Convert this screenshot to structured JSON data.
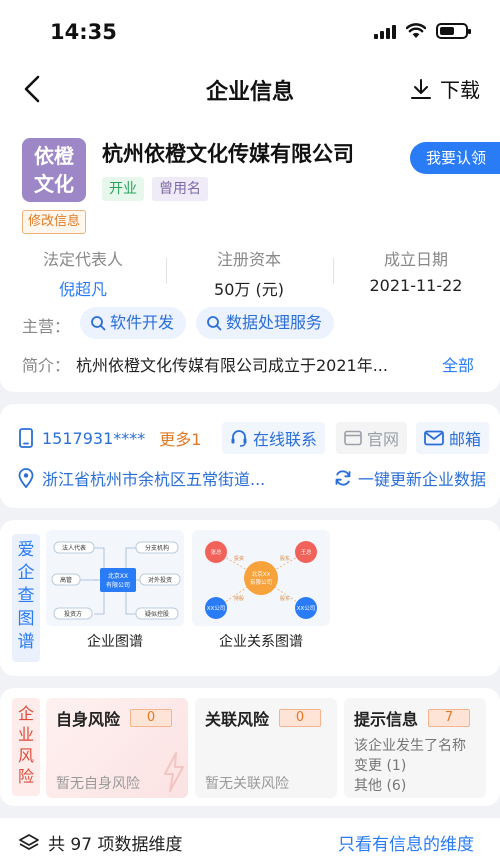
{
  "status": {
    "time": "14:35"
  },
  "nav": {
    "title": "企业信息",
    "download": "下载"
  },
  "company": {
    "logo_line1": "依橙",
    "logo_line2": "文化",
    "name": "杭州依橙文化传媒有限公司",
    "claim": "我要认领",
    "tag_status": "开业",
    "tag_former": "曾用名",
    "modify": "修改信息",
    "legal_rep_label": "法定代表人",
    "legal_rep_value": "倪超凡",
    "capital_label": "注册资本",
    "capital_value": "50万 (元)",
    "founded_label": "成立日期",
    "founded_value": "2021-11-22",
    "main_label": "主营：",
    "main_items": [
      "软件开发",
      "数据处理服务"
    ],
    "intro_label": "简介：",
    "intro_text": "杭州依橙文化传媒有限公司成立于2021年...",
    "intro_all": "全部"
  },
  "contact": {
    "phone": "1517931****",
    "more": "更多1",
    "online": "在线联系",
    "website": "官网",
    "email": "邮箱",
    "address": "浙江省杭州市余杭区五常街道...",
    "update": "一键更新企业数据"
  },
  "graph": {
    "side_label": [
      "爱",
      "企",
      "查",
      "图",
      "谱"
    ],
    "items": [
      {
        "caption": "企业图谱",
        "center": [
          "北京XX",
          "有限公司"
        ],
        "nodes": [
          "法人代表",
          "分支机构",
          "高管",
          "对外投资",
          "投资方",
          "疑似控股"
        ]
      },
      {
        "caption": "企业关系图谱",
        "center": [
          "北京XX",
          "有限公司"
        ],
        "nodes": [
          "张总",
          "王总",
          "XX公司",
          "XX公司"
        ],
        "links": [
          "投资",
          "股东",
          "持股",
          "股东"
        ]
      }
    ]
  },
  "risk": {
    "side_label": [
      "企",
      "业",
      "风",
      "险"
    ],
    "self_title": "自身风险",
    "self_count": "0",
    "self_sub": "暂无自身风险",
    "related_title": "关联风险",
    "related_count": "0",
    "related_sub": "暂无关联风险",
    "hint_title": "提示信息",
    "hint_count": "7",
    "hint_lines": [
      "该企业发生了名称",
      "变更 (1)",
      "其他 (6)"
    ]
  },
  "footer": {
    "left": "共 97 项数据维度",
    "right": "只看有信息的维度"
  },
  "colors": {
    "accent": "#2a7cf6",
    "orange": "#e07a26",
    "logo": "#9d87c6",
    "risk_red": "#e04a3a"
  }
}
